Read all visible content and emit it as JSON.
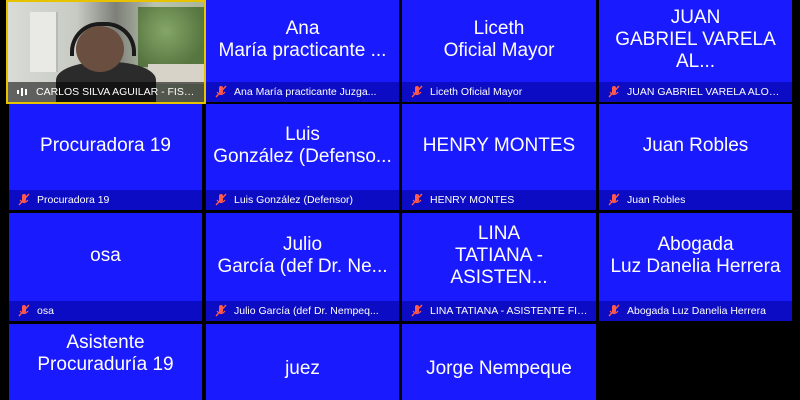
{
  "self": {
    "label": "CARLOS SILVA AGUILAR - FISC..."
  },
  "participants": [
    {
      "name": "Ana\nMaría practicante ...",
      "label": "Ana María practicante Juzga..."
    },
    {
      "name": "Liceth\nOficial Mayor",
      "label": "Liceth Oficial Mayor"
    },
    {
      "name": "JUAN\nGABRIEL VARELA AL...",
      "label": "JUAN GABRIEL VARELA ALONS..."
    },
    {
      "name": "Procuradora 19",
      "label": "Procuradora 19"
    },
    {
      "name": "Luis\nGonzález (Defenso...",
      "label": "Luis González (Defensor)"
    },
    {
      "name": "HENRY MONTES",
      "label": "HENRY MONTES"
    },
    {
      "name": "Juan Robles",
      "label": "Juan Robles"
    },
    {
      "name": "osa",
      "label": "osa"
    },
    {
      "name": "Julio\nGarcía (def Dr. Ne...",
      "label": "Julio García (def Dr. Nempeq..."
    },
    {
      "name": "LINA\nTATIANA - ASISTEN...",
      "label": "LINA TATIANA - ASISTENTE FIS..."
    },
    {
      "name": "Abogada\nLuz Danelia Herrera",
      "label": "Abogada Luz Danelia Herrera"
    },
    {
      "name": "Asistente\nProcuraduría 19",
      "label": ""
    },
    {
      "name": "juez",
      "label": ""
    },
    {
      "name": "Jorge Nempeque",
      "label": ""
    }
  ],
  "colors": {
    "tile": "#1a1aff",
    "label_bar": "#0c0cc4",
    "muted_icon": "#ff5a4a",
    "active_speaker_border": "#e6c200"
  }
}
